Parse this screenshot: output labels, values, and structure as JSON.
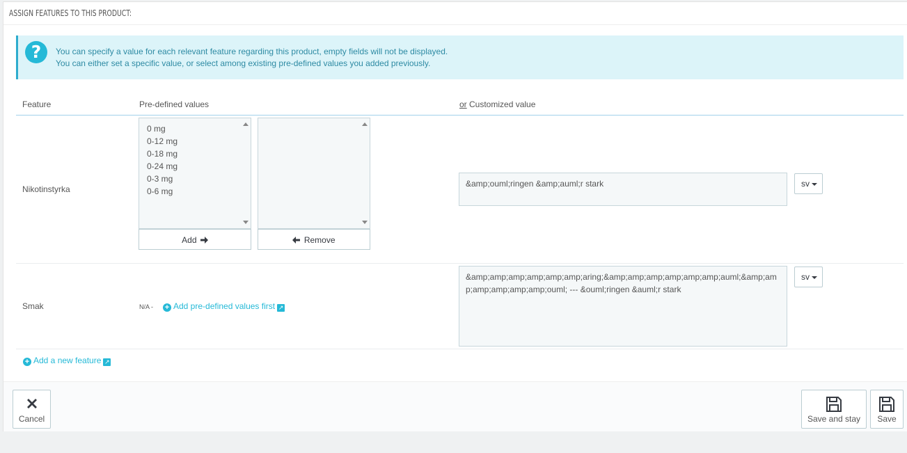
{
  "panel": {
    "title": "ASSIGN FEATURES TO THIS PRODUCT:"
  },
  "alert": {
    "line1": "You can specify a value for each relevant feature regarding this product, empty fields will not be displayed.",
    "line2": "You can either set a specific value, or select among existing pre-defined values you added previously."
  },
  "table": {
    "headers": {
      "feature": "Feature",
      "predefined": "Pre-defined values",
      "or": "or",
      "customized": " Customized value"
    },
    "rows": [
      {
        "feature": "Nikotinstyrka",
        "available_values": [
          "0 mg",
          "0-12 mg",
          "0-18 mg",
          "0-24 mg",
          "0-3 mg",
          "0-6 mg"
        ],
        "selected_values": [],
        "add_label": "Add",
        "remove_label": "Remove",
        "custom_value": "&amp;ouml;ringen &amp;auml;r stark",
        "lang": "sv"
      },
      {
        "feature": "Smak",
        "na_label": "N/A -",
        "add_predefined_label": "Add pre-defined values first",
        "custom_value": "&amp;amp;amp;amp;amp;amp;aring;&amp;amp;amp;amp;amp;amp;auml;&amp;amp;amp;amp;amp;amp;ouml; --- &ouml;ringen &auml;r stark",
        "lang": "sv"
      }
    ]
  },
  "add_feature_label": "Add a new feature",
  "footer": {
    "cancel": "Cancel",
    "save_and_stay": "Save and stay",
    "save": "Save"
  }
}
